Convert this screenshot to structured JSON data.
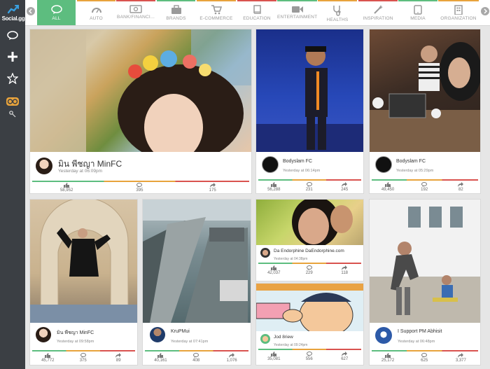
{
  "app": {
    "brand": "Social.gg"
  },
  "categories": [
    {
      "label": "ALL",
      "icon": "chat-bubbles-icon",
      "active": true,
      "stripe": "#5dbd7f"
    },
    {
      "label": "AUTO",
      "icon": "speedometer-icon",
      "stripe": "#e8a33c"
    },
    {
      "label": "BANK/FINANCI...",
      "icon": "banknote-icon",
      "stripe": "#d9534f"
    },
    {
      "label": "BRANDS",
      "icon": "briefcase-icon",
      "stripe": "#5dbd7f"
    },
    {
      "label": "E-COMMERCE",
      "icon": "cart-icon",
      "stripe": "#e8a33c"
    },
    {
      "label": "EDUCATION",
      "icon": "book-icon",
      "stripe": "#d9534f"
    },
    {
      "label": "ENTERTAINMENT",
      "icon": "video-camera-icon",
      "stripe": "#5dbd7f"
    },
    {
      "label": "HEALTHS",
      "icon": "stethoscope-icon",
      "stripe": "#e8a33c"
    },
    {
      "label": "INSPIRATION",
      "icon": "magic-wand-icon",
      "stripe": "#d9534f"
    },
    {
      "label": "MEDIA",
      "icon": "tablet-icon",
      "stripe": "#5dbd7f"
    },
    {
      "label": "ORGANIZATION",
      "icon": "building-icon",
      "stripe": "#e8a33c"
    }
  ],
  "posts": [
    {
      "name": "มิน พีชญา MinFC",
      "time": "Yesterday at 06:09pm",
      "likes": "58,952",
      "comments": "395",
      "shares": "175"
    },
    {
      "name": "Bodyslam FC",
      "time": "Yesterday at 06:14pm",
      "likes": "56,288",
      "comments": "231",
      "shares": "245"
    },
    {
      "name": "Bodyslam FC",
      "time": "Yesterday at 05:29pm",
      "likes": "49,450",
      "comments": "192",
      "shares": "82"
    },
    {
      "name": "มิน พีชญา MinFC",
      "time": "Yesterday at 09:58pm",
      "likes": "45,772",
      "comments": "375",
      "shares": "89"
    },
    {
      "name": "KruPMui",
      "time": "Yesterday at 07:41pm",
      "likes": "40,161",
      "comments": "408",
      "shares": "1,076"
    },
    {
      "name": "Da Endorphine DaEndorphine.com",
      "time": "Yesterday at 04:38pm",
      "likes": "42,037",
      "comments": "229",
      "shares": "118"
    },
    {
      "name": "Jod 8riew",
      "time": "Yesterday at 09:24pm",
      "likes": "35,081",
      "comments": "556",
      "shares": "627"
    },
    {
      "name": "I Support PM Abhisit",
      "time": "Yesterday at 06:48pm",
      "likes": "25,172",
      "comments": "625",
      "shares": "3,377"
    }
  ],
  "colors": {
    "sidebar": "#3b3f44",
    "accent": "#5dbd7f",
    "orange": "#e8a33c",
    "red": "#d9534f"
  }
}
